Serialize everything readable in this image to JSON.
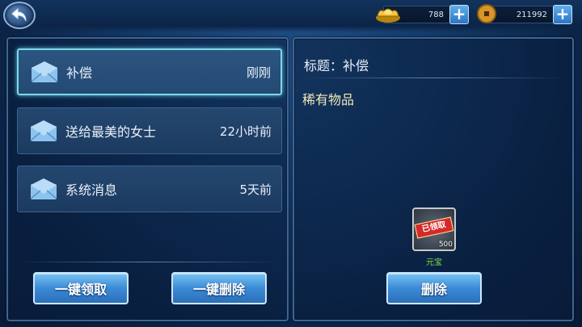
{
  "currencies": {
    "gold_ingot": {
      "value": "788",
      "icon": "gold-ingot-icon"
    },
    "coin": {
      "value": "211992",
      "icon": "copper-coin-icon"
    },
    "plus_label": "+"
  },
  "mail_list": [
    {
      "subject": "补偿",
      "time": "刚刚",
      "selected": true
    },
    {
      "subject": "送给最美的女士",
      "time": "22小时前",
      "selected": false
    },
    {
      "subject": "系统消息",
      "time": "5天前",
      "selected": false
    }
  ],
  "left_buttons": {
    "claim_all": "一键领取",
    "delete_all": "一键删除"
  },
  "detail": {
    "title_prefix": "标题：",
    "title": "补偿",
    "body": "稀有物品",
    "attachment": {
      "stamp": "已领取",
      "count": "500",
      "name": "元宝"
    },
    "delete_label": "删除"
  },
  "colors": {
    "accent_blue": "#3b8ad6",
    "selected_border": "#7fd6e6",
    "item_name": "#7ee14a",
    "stamp_red": "#d42a2a"
  }
}
